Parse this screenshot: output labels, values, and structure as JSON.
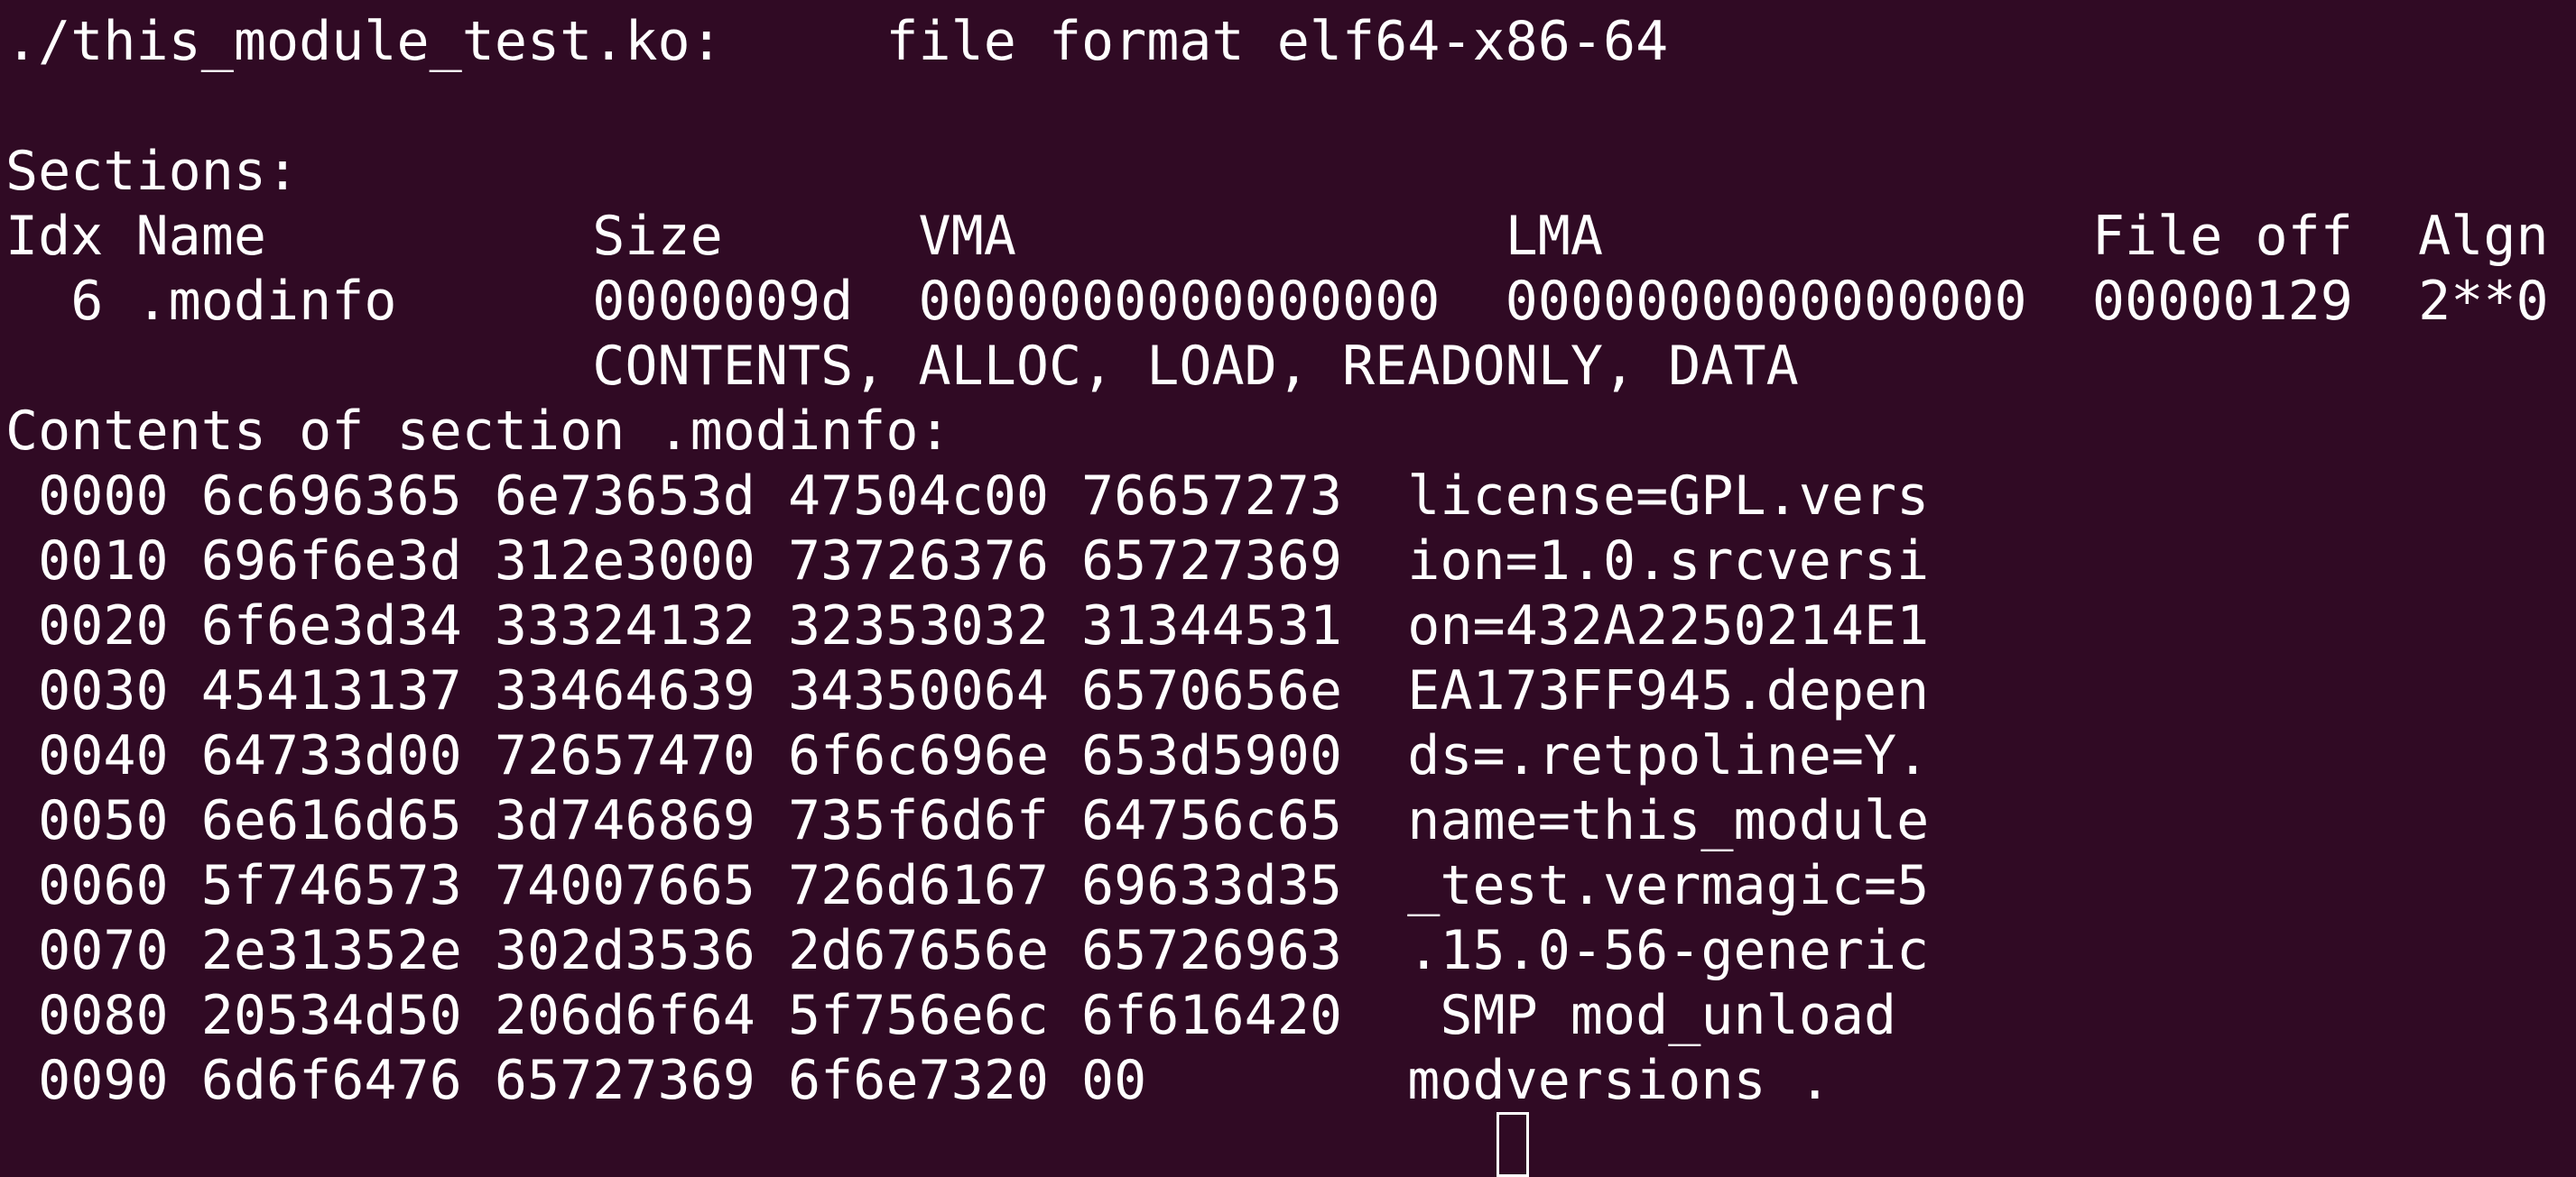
{
  "terminal": {
    "background_color": "#300a24",
    "text_color": "#ffffff",
    "header_line": "./this_module_test.ko:     file format elf64-x86-64",
    "sections_label": "Sections:",
    "section_table": {
      "header_line": "Idx Name          Size      VMA               LMA               File off  Algn",
      "row_line": "  6 .modinfo      0000009d  0000000000000000  0000000000000000  00000129  2**0",
      "flags_line": "                  CONTENTS, ALLOC, LOAD, READONLY, DATA"
    },
    "contents_label": "Contents of section .modinfo:",
    "hex_dump": [
      " 0000 6c696365 6e73653d 47504c00 76657273  license=GPL.vers",
      " 0010 696f6e3d 312e3000 73726376 65727369  ion=1.0.srcversi",
      " 0020 6f6e3d34 33324132 32353032 31344531  on=432A2250214E1",
      " 0030 45413137 33464639 34350064 6570656e  EA173FF945.depen",
      " 0040 64733d00 72657470 6f6c696e 653d5900  ds=.retpoline=Y.",
      " 0050 6e616d65 3d746869 735f6d6f 64756c65  name=this_module",
      " 0060 5f746573 74007665 726d6167 69633d35  _test.vermagic=5",
      " 0070 2e31352e 302d3536 2d67656e 65726963  .15.0-56-generic",
      " 0080 20534d50 206d6f64 5f756e6c 6f616420   SMP mod_unload ",
      " 0090 6d6f6476 65727369 6f6e7320 00        modversions ."
    ]
  }
}
